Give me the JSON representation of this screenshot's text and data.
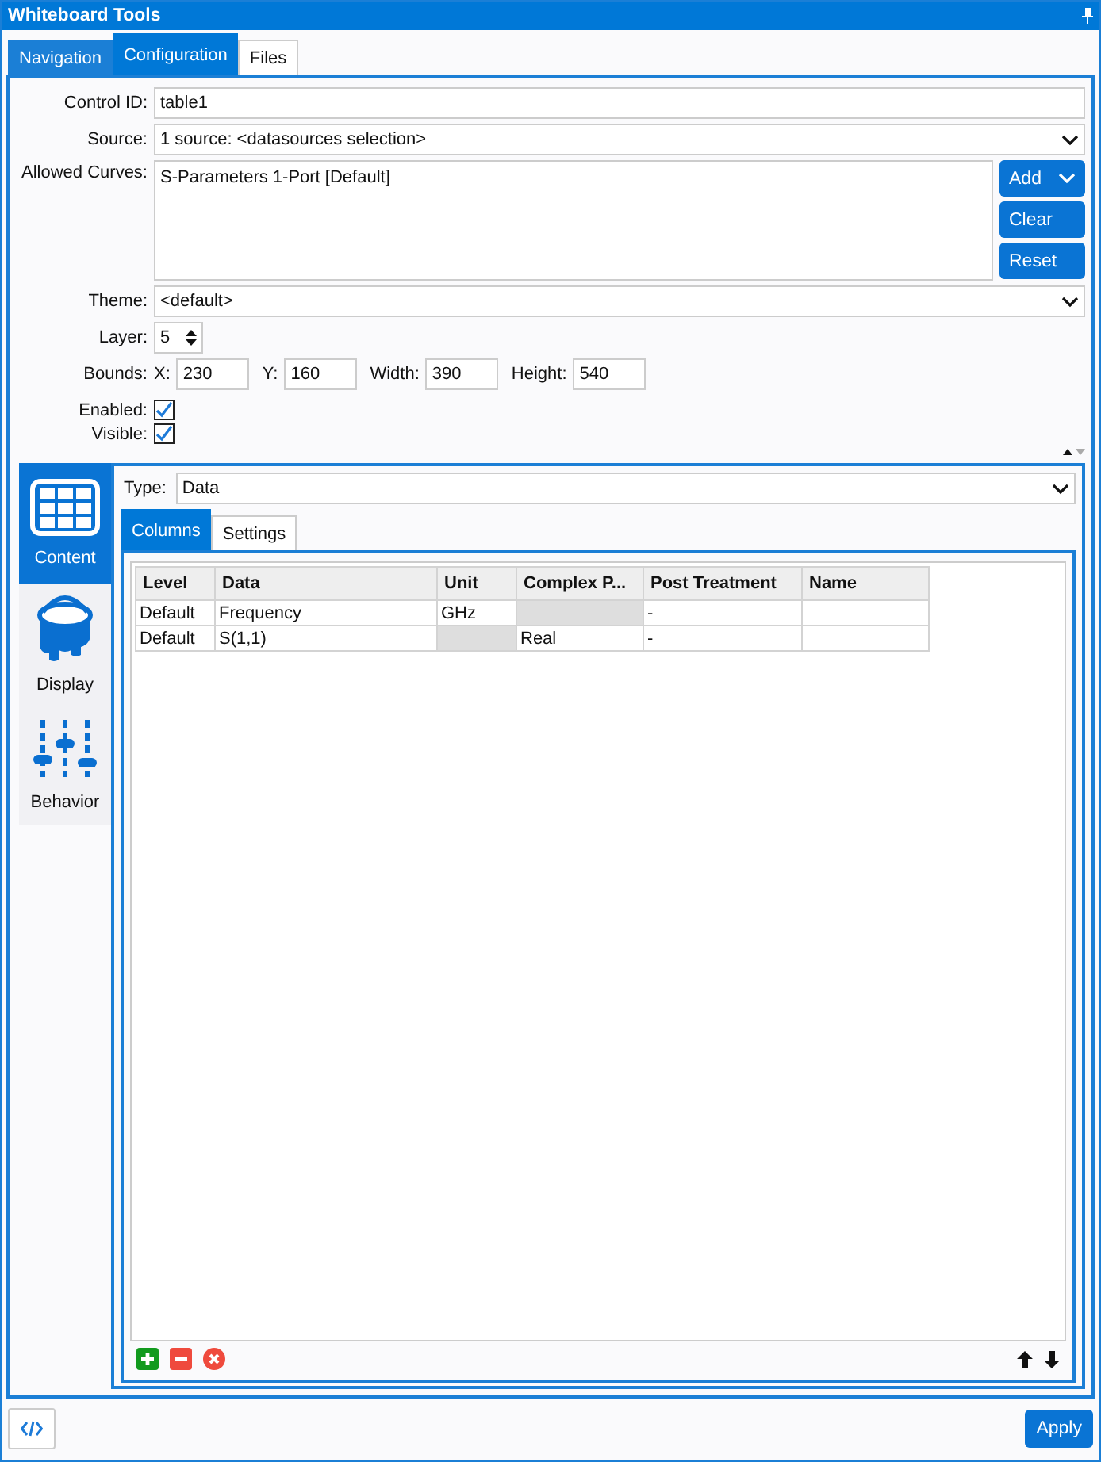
{
  "window": {
    "title": "Whiteboard Tools"
  },
  "tabs": [
    {
      "label": "Navigation",
      "selected": false,
      "hovered": true
    },
    {
      "label": "Configuration",
      "selected": true,
      "hovered": false
    },
    {
      "label": "Files",
      "selected": false,
      "hovered": false
    }
  ],
  "form": {
    "control_id": {
      "label": "Control ID:",
      "value": "table1"
    },
    "source": {
      "label": "Source:",
      "value": "1 source: <datasources selection>"
    },
    "allowed_curves": {
      "label": "Allowed Curves:",
      "items": [
        "S-Parameters 1-Port [Default]"
      ],
      "buttons": [
        {
          "label": "Add",
          "dropdown": true
        },
        {
          "label": "Clear",
          "dropdown": false
        },
        {
          "label": "Reset",
          "dropdown": false
        }
      ]
    },
    "theme": {
      "label": "Theme:",
      "value": "<default>"
    },
    "layer": {
      "label": "Layer:",
      "value": "5"
    },
    "bounds": {
      "label": "Bounds:",
      "fields": [
        {
          "label": "X:",
          "value": "230"
        },
        {
          "label": "Y:",
          "value": "160"
        },
        {
          "label": "Width:",
          "value": "390"
        },
        {
          "label": "Height:",
          "value": "540"
        }
      ]
    },
    "checkboxes": [
      {
        "label": "Enabled:",
        "checked": true
      },
      {
        "label": "Visible:",
        "checked": true
      }
    ]
  },
  "sidebar": {
    "items": [
      {
        "label": "Content",
        "kind": "table",
        "selected": true
      },
      {
        "label": "Display",
        "kind": "bucket",
        "selected": false
      },
      {
        "label": "Behavior",
        "kind": "sliders",
        "selected": false
      }
    ]
  },
  "content": {
    "type": {
      "label": "Type:",
      "value": "Data"
    },
    "tabs": [
      {
        "label": "Columns",
        "selected": true
      },
      {
        "label": "Settings",
        "selected": false
      }
    ],
    "table": {
      "columns": [
        "Level",
        "Data",
        "Unit",
        "Complex P...",
        "Post Treatment",
        "Name"
      ],
      "rows": [
        [
          {
            "text": "Default",
            "disabled": false
          },
          {
            "text": "Frequency",
            "disabled": false
          },
          {
            "text": "GHz",
            "disabled": false
          },
          {
            "disabled": true
          },
          {
            "text": "-",
            "disabled": false
          },
          {
            "disabled": false
          }
        ],
        [
          {
            "text": "Default",
            "disabled": false
          },
          {
            "text": "S(1,1)",
            "disabled": false
          },
          {
            "disabled": true
          },
          {
            "text": "Real",
            "disabled": false
          },
          {
            "text": "-",
            "disabled": false
          },
          {
            "disabled": false
          }
        ]
      ]
    }
  },
  "buttons": [
    "Apply"
  ]
}
